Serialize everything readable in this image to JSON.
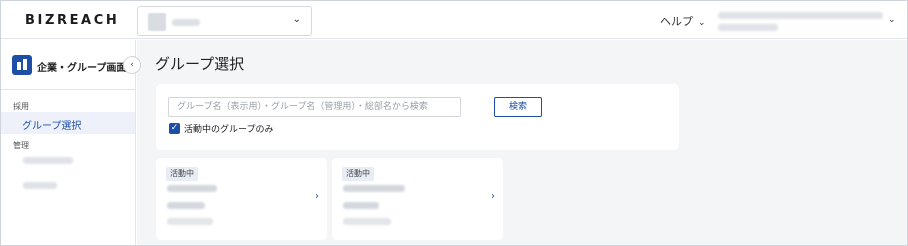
{
  "header": {
    "logo": "BIZREACH",
    "help_label": "ヘルプ"
  },
  "sidebar": {
    "title": "企業・グループ画面",
    "sections": [
      {
        "label": "採用",
        "items": [
          {
            "label": "グループ選択",
            "active": true
          }
        ]
      },
      {
        "label": "管理",
        "items": []
      }
    ]
  },
  "main": {
    "page_title": "グループ選択",
    "search": {
      "placeholder": "グループ名（表示用）・グループ名（管理用）・総部名から検索",
      "button_label": "検索",
      "checkbox_label": "活動中のグループのみ",
      "checkbox_checked": true
    },
    "cards": [
      {
        "status": "活動中"
      },
      {
        "status": "活動中"
      }
    ]
  },
  "colors": {
    "accent": "#1d4fa6",
    "active_nav_bg": "#eef1fa",
    "main_bg": "#f4f5f7"
  },
  "icons": {
    "company_select_chevron": "chevron-down-icon",
    "collapse": "chevron-left-icon",
    "card_arrow": "chevron-right-icon",
    "sidebar": "building-icon"
  }
}
